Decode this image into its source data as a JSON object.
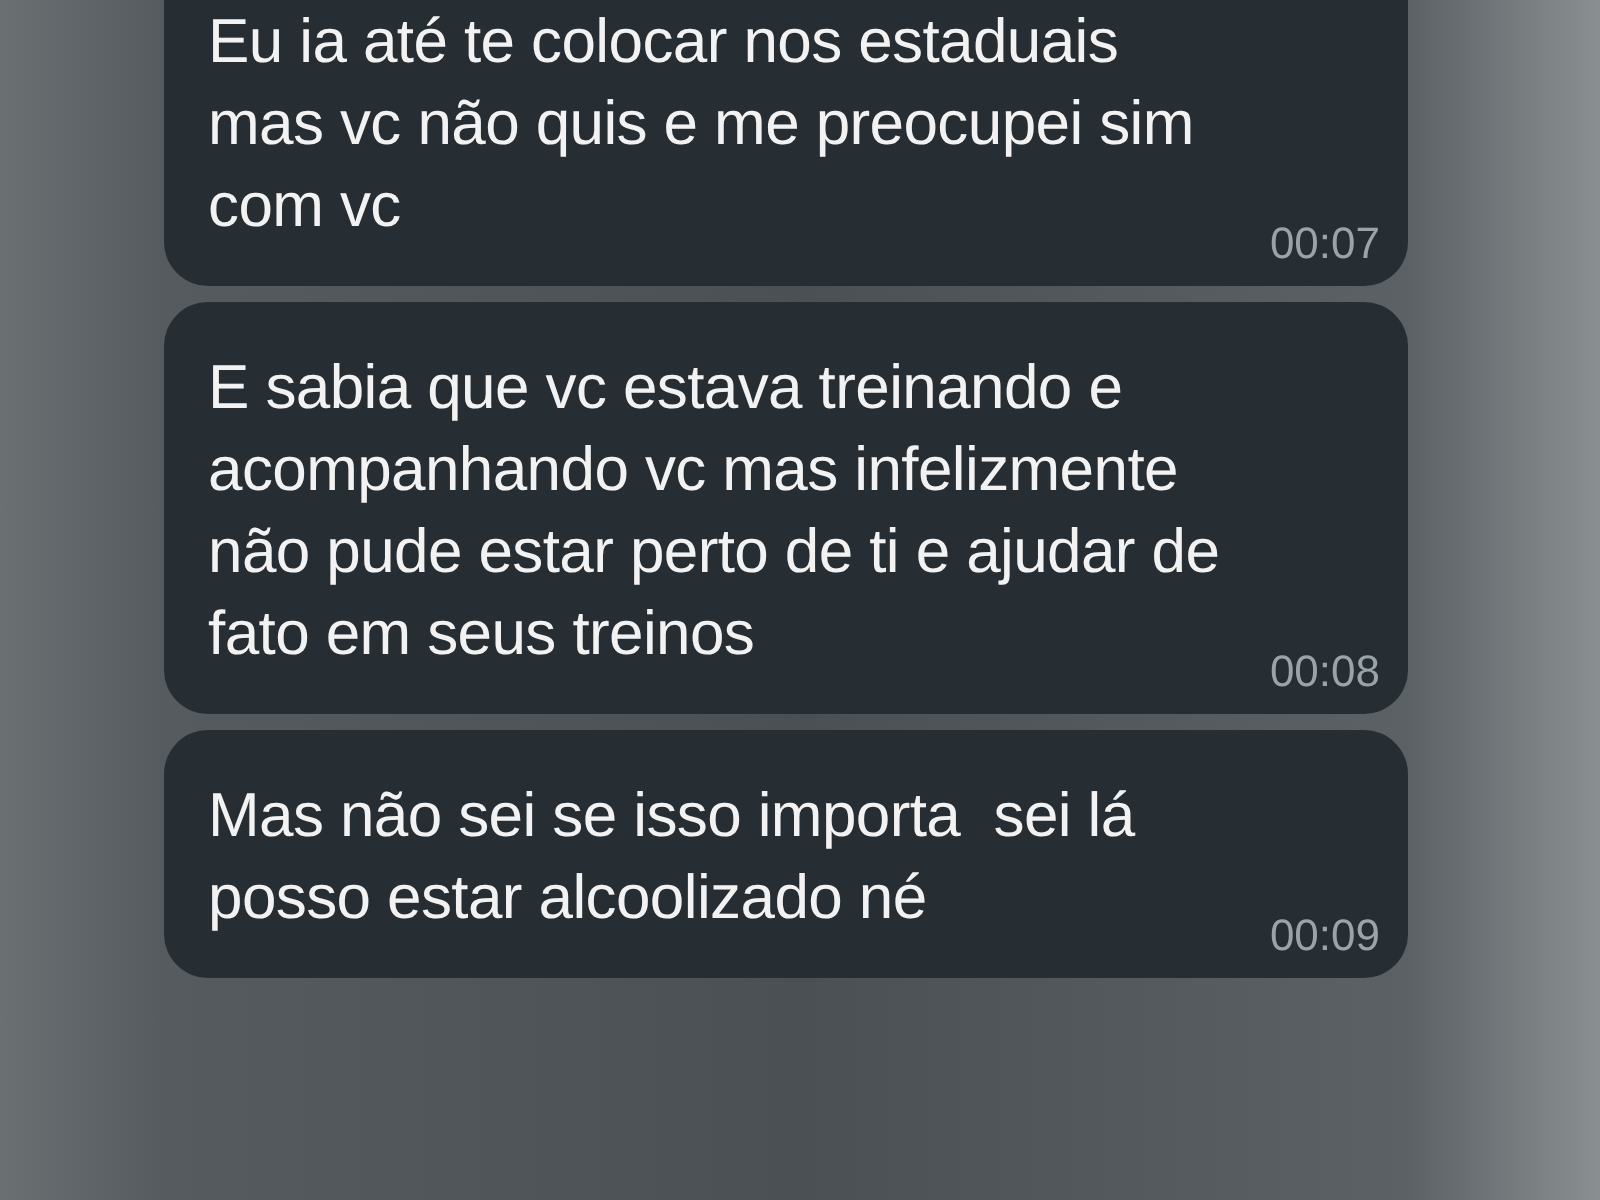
{
  "messages": [
    {
      "text": "Eu ia até te colocar nos estaduais\nmas vc não quis e me preocupei sim\ncom vc",
      "time": "00:07"
    },
    {
      "text": "E sabia que vc estava treinando e\nacompanhando vc mas infelizmente\nnão pude estar perto de ti e ajudar de\nfato em seus treinos",
      "time": "00:08"
    },
    {
      "text": "Mas não sei se isso importa  sei lá\nposso estar alcoolizado né",
      "time": "00:09"
    }
  ]
}
